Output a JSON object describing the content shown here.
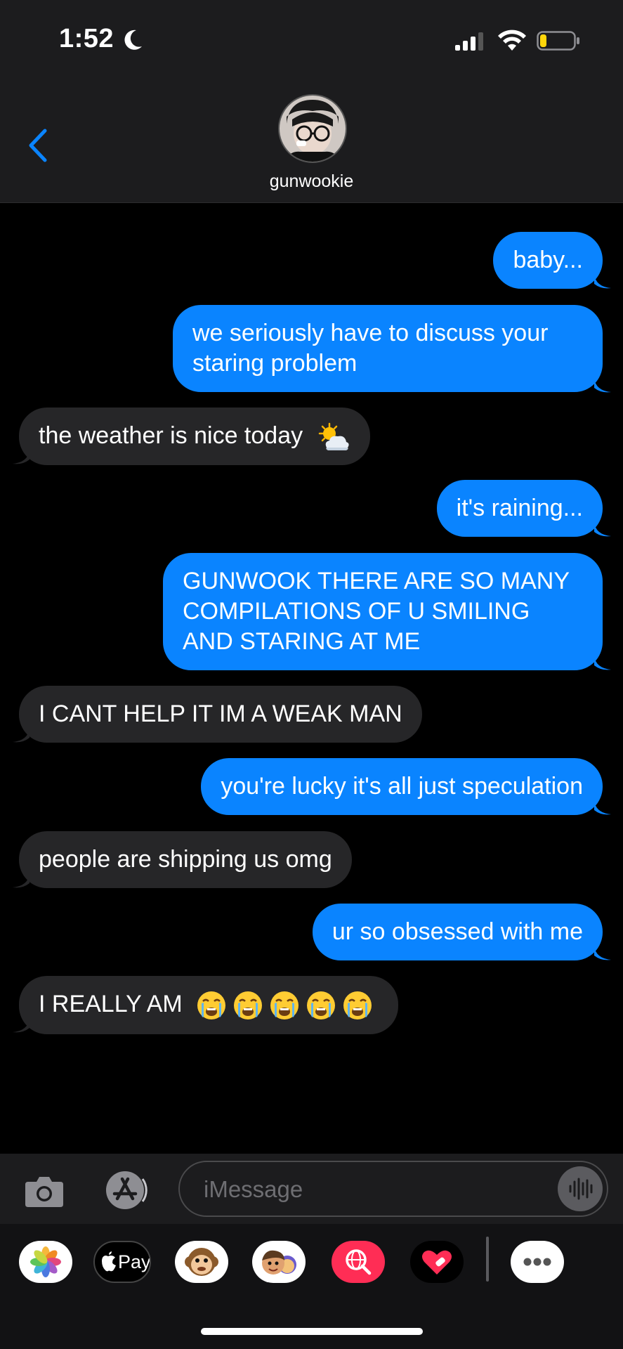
{
  "status_bar": {
    "time": "1:52",
    "battery_level": 0.2,
    "battery_color": "#ffd60a"
  },
  "header": {
    "contact_name": "gunwookie",
    "back_icon": "chevron-left-icon",
    "accent": "#0a84ff"
  },
  "messages": [
    {
      "from": "me",
      "text": "baby..."
    },
    {
      "from": "me",
      "lines": [
        "we seriously have to discuss your",
        "staring problem"
      ]
    },
    {
      "from": "them",
      "text": "the weather is nice today",
      "emoji": "sun-behind-cloud-icon"
    },
    {
      "from": "me",
      "text": "it's raining..."
    },
    {
      "from": "me",
      "lines": [
        "GUNWOOK THERE ARE SO MANY",
        "COMPILATIONS OF U SMILING",
        "AND STARING AT ME"
      ]
    },
    {
      "from": "them",
      "text": "I CANT HELP IT IM A WEAK MAN"
    },
    {
      "from": "me",
      "text": "you're lucky it's all just speculation"
    },
    {
      "from": "them",
      "text": "people are shipping us omg"
    },
    {
      "from": "me",
      "text": "ur so obsessed with me"
    },
    {
      "from": "them",
      "text": "I REALLY AM",
      "emoji_count": 5,
      "emoji": "loudly-crying-face-icon"
    }
  ],
  "input": {
    "placeholder": "iMessage"
  },
  "apps": [
    {
      "name": "photos-app-icon"
    },
    {
      "name": "apple-pay-app-icon",
      "label": "Pay"
    },
    {
      "name": "animoji-app-icon"
    },
    {
      "name": "memoji-app-icon"
    },
    {
      "name": "web-images-app-icon"
    },
    {
      "name": "digital-touch-app-icon"
    },
    {
      "name": "more-apps-icon"
    }
  ],
  "colors": {
    "sent_bubble": "#0a84ff",
    "received_bubble": "#262628"
  }
}
